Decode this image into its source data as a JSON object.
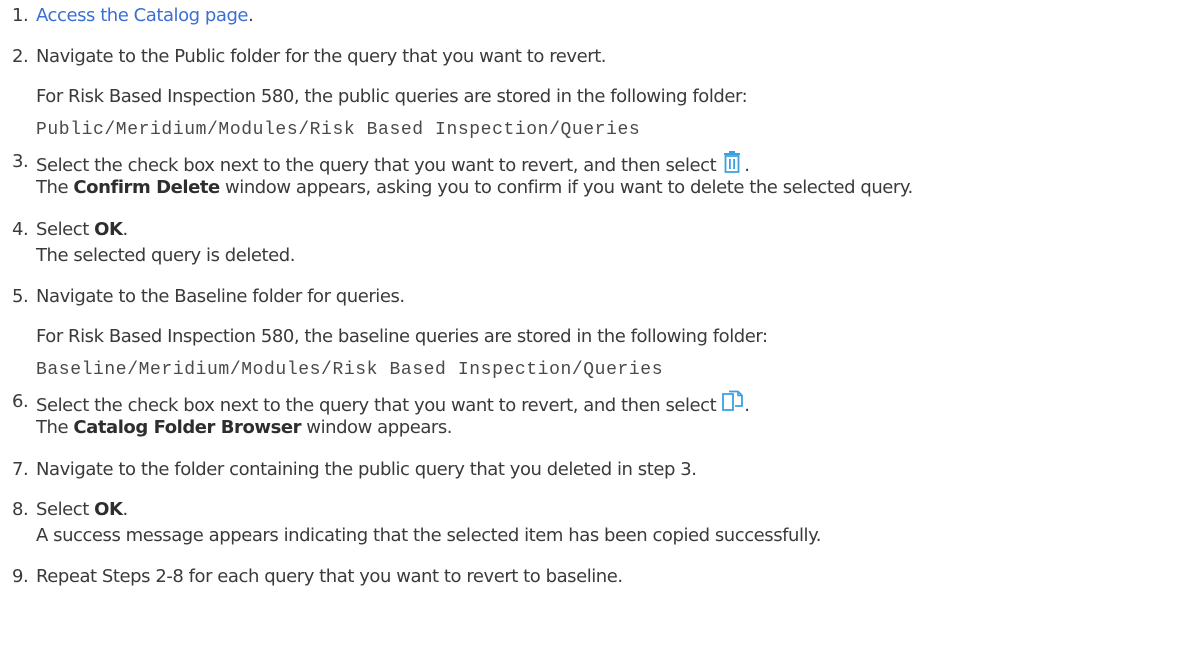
{
  "steps": [
    {
      "num": "1.",
      "link": "Access the Catalog page",
      "tail": "."
    },
    {
      "num": "2.",
      "text": "Navigate to the Public folder for the query that you want to revert.",
      "note": "For Risk Based Inspection 580, the public queries are stored in the following folder:",
      "path": "Public/Meridium/Modules/Risk Based Inspection/Queries"
    },
    {
      "num": "3.",
      "text": "Select the check box next to the query that you want to revert, and then select",
      "icon": "trash-icon",
      "after_icon": ".",
      "result_pre": "The ",
      "result_bold": "Confirm Delete",
      "result_post": " window appears, asking you to confirm if you want to delete the selected query."
    },
    {
      "num": "4.",
      "pre": "Select ",
      "bold": "OK",
      "post": ".",
      "result": "The selected query is deleted."
    },
    {
      "num": "5.",
      "text": "Navigate to the Baseline folder for queries.",
      "note": "For Risk Based Inspection 580, the baseline queries are stored in the following folder:",
      "path": "Baseline/Meridium/Modules/Risk Based Inspection/Queries"
    },
    {
      "num": "6.",
      "text": "Select the check box next to the query that you want to revert, and then select",
      "icon": "copy-icon",
      "after_icon": ".",
      "result_pre": "The ",
      "result_bold": "Catalog Folder Browser",
      "result_post": " window appears."
    },
    {
      "num": "7.",
      "text": "Navigate to the folder containing the public query that you deleted in step 3."
    },
    {
      "num": "8.",
      "pre": "Select ",
      "bold": "OK",
      "post": ".",
      "result": "A success message appears indicating that the selected item has been copied successfully."
    },
    {
      "num": "9.",
      "text": "Repeat Steps 2-8 for each query that you want to revert to baseline."
    }
  ],
  "colors": {
    "text": "#3a3a3a",
    "link": "#3b6fd1",
    "icon": "#3aa0e0"
  }
}
